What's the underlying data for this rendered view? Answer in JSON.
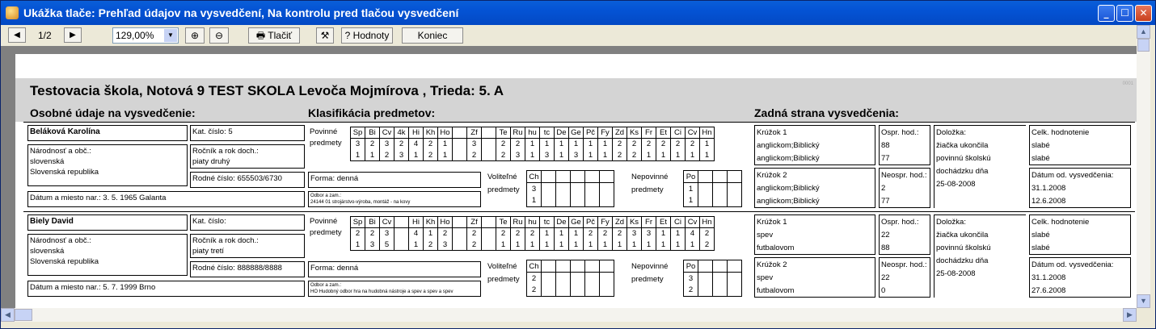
{
  "window": {
    "title": "Ukážka tlače: Prehľad údajov na vysvedčení, Na kontrolu pred tlačou vysvedčení"
  },
  "toolbar": {
    "page": "1/2",
    "zoom": "129,00%",
    "print_label": "Tlačiť",
    "values_label": "Hodnoty",
    "end_label": "Koniec"
  },
  "report": {
    "title": "Testovacia škola, Notová 9 TEST SKOLA Levoča Mojmírova , Trieda: 5. A",
    "sec_personal": "Osobné údaje na vysvedčenie:",
    "sec_grades": "Klasifikácia predmetov:",
    "sec_back": "Zadná strana vysvedčenia:",
    "page_code": "0001"
  },
  "students": [
    {
      "name": "Beláková Karolína",
      "nat_label": "Národnosť a obč.:",
      "nationality": "slovenská",
      "citizenship": "Slovenská republika",
      "kat": "Kat. číslo: 5",
      "rocnik_label": "Ročník a rok doch.:",
      "rocnik": "piaty druhý",
      "rodne": "Rodné číslo: 655503/6730",
      "datum": "Dátum a miesto nar.: 3. 5. 1965 Galanta",
      "povinne1": "Povinné",
      "povinne2": "predmety",
      "subjects": [
        "Sp",
        "Bi",
        "Cv",
        "4k",
        "Hi",
        "Kh",
        "Ho",
        "",
        "Zf",
        "",
        "Te",
        "Ru",
        "hu",
        "tc",
        "De",
        "Ge",
        "Pč",
        "Fy",
        "Zd",
        "Ks",
        "Fr",
        "Et",
        "Ci",
        "Cv",
        "Hn"
      ],
      "grades1": [
        "3",
        "2",
        "3",
        "2",
        "4",
        "2",
        "1",
        "",
        "3",
        "",
        "2",
        "2",
        "1",
        "1",
        "1",
        "1",
        "1",
        "1",
        "2",
        "2",
        "2",
        "2",
        "2",
        "2",
        "1"
      ],
      "grades2": [
        "1",
        "1",
        "2",
        "3",
        "1",
        "2",
        "1",
        "",
        "2",
        "",
        "2",
        "3",
        "1",
        "3",
        "1",
        "3",
        "1",
        "1",
        "2",
        "2",
        "1",
        "1",
        "1",
        "1",
        "1"
      ],
      "forma": "Forma: denná",
      "odbor_label": "Odbor a zam.:",
      "odbor": "24144 01 strojárstvo-výroba, montáž - na kovy",
      "volitelne1": "Voliteľné",
      "volitelne2": "predmety",
      "vol_subj": "Ch",
      "vol_g1": "3",
      "vol_g2": "1",
      "nepov1": "Nepovinné",
      "nepov2": "predmety",
      "nep_subj": "Po",
      "nep_g1": "1",
      "nep_g2": "1",
      "kruzok1_label": "Krúžok 1",
      "kruzok1_a": "anglickom;Biblický",
      "kruzok1_b": "anglickom;Biblický",
      "kruzok2_label": "Krúžok 2",
      "kruzok2_a": "anglickom;Biblický",
      "kruzok2_b": "anglickom;Biblický",
      "ospr_label": "Ospr. hod.:",
      "ospr_a": "88",
      "ospr_b": "77",
      "neospr_label": "Neospr. hod.:",
      "neospr_a": "2",
      "neospr_b": "77",
      "dolozka_label": "Doložka:",
      "dolozka1": "žiačka ukončila",
      "dolozka2": "povinnú školskú",
      "dolozka3": "dochádzku dňa",
      "dolozka4": "25-08-2008",
      "celk_label": "Celk. hodnotenie",
      "celk_a": "slabé",
      "celk_b": "slabé",
      "datum_vys_label": "Dátum od. vysvedčenia:",
      "datum_vys_a": "31.1.2008",
      "datum_vys_b": "12.6.2008"
    },
    {
      "name": "Biely David",
      "nat_label": "Národnosť a obč.:",
      "nationality": "slovenská",
      "citizenship": "Slovenská republika",
      "kat": "Kat. číslo:",
      "rocnik_label": "Ročník a rok doch.:",
      "rocnik": "piaty tretí",
      "rodne": "Rodné číslo: 888888/8888",
      "datum": "Dátum a miesto nar.: 5. 7. 1999 Brno",
      "povinne1": "Povinné",
      "povinne2": "predmety",
      "subjects": [
        "Sp",
        "Bi",
        "Cv",
        "",
        "Hi",
        "Kh",
        "Ho",
        "",
        "Zf",
        "",
        "Te",
        "Ru",
        "hu",
        "tc",
        "De",
        "Ge",
        "Pč",
        "Fy",
        "Zd",
        "Ks",
        "Fr",
        "Et",
        "Ci",
        "Cv",
        "Hn"
      ],
      "grades1": [
        "2",
        "2",
        "3",
        "",
        "4",
        "1",
        "2",
        "",
        "2",
        "",
        "2",
        "2",
        "2",
        "1",
        "1",
        "1",
        "2",
        "2",
        "2",
        "3",
        "3",
        "1",
        "1",
        "4",
        "2"
      ],
      "grades2": [
        "1",
        "3",
        "5",
        "",
        "1",
        "2",
        "3",
        "",
        "2",
        "",
        "1",
        "1",
        "1",
        "1",
        "1",
        "1",
        "1",
        "1",
        "1",
        "1",
        "1",
        "1",
        "1",
        "1",
        "2"
      ],
      "forma": "Forma: denná",
      "odbor_label": "Odbor a zam.:",
      "odbor": "HO Hudobný odbor hra na hudobná nástroje a spev a spev a spev",
      "volitelne1": "Voliteľné",
      "volitelne2": "predmety",
      "vol_subj": "Ch",
      "vol_g1": "2",
      "vol_g2": "2",
      "nepov1": "Nepovinné",
      "nepov2": "predmety",
      "nep_subj": "Po",
      "nep_g1": "3",
      "nep_g2": "2",
      "kruzok1_label": "Krúžok 1",
      "kruzok1_a": "spev",
      "kruzok1_b": "futbalovom",
      "kruzok2_label": "Krúžok 2",
      "kruzok2_a": "spev",
      "kruzok2_b": "futbalovom",
      "ospr_label": "Ospr. hod.:",
      "ospr_a": "22",
      "ospr_b": "88",
      "neospr_label": "Neospr. hod.:",
      "neospr_a": "22",
      "neospr_b": "0",
      "dolozka_label": "Doložka:",
      "dolozka1": "žiačka ukončila",
      "dolozka2": "povinnú školskú",
      "dolozka3": "dochádzku dňa",
      "dolozka4": "25-08-2008",
      "celk_label": "Celk. hodnotenie",
      "celk_a": "slabé",
      "celk_b": "slabé",
      "datum_vys_label": "Dátum od. vysvedčenia:",
      "datum_vys_a": "31.1.2008",
      "datum_vys_b": "27.6.2008"
    }
  ]
}
